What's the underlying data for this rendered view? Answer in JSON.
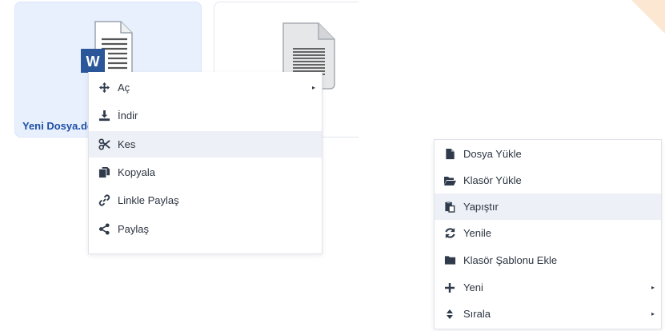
{
  "files": [
    {
      "name": "Yeni Dosya.docx",
      "type": "word-document-icon",
      "selected": true
    },
    {
      "name": "",
      "type": "text-document-icon",
      "selected": false
    }
  ],
  "file_context_menu": {
    "items": [
      {
        "label": "Aç",
        "icon": "move-icon",
        "submenu": true,
        "highlighted": false
      },
      {
        "label": "İndir",
        "icon": "download-icon",
        "submenu": false,
        "highlighted": false
      },
      {
        "label": "Kes",
        "icon": "scissors-icon",
        "submenu": false,
        "highlighted": true
      },
      {
        "label": "Kopyala",
        "icon": "copy-icon",
        "submenu": false,
        "highlighted": false
      },
      {
        "label": "Linkle Paylaş",
        "icon": "link-icon",
        "submenu": false,
        "highlighted": false
      },
      {
        "label": "Paylaş",
        "icon": "share-icon",
        "submenu": false,
        "highlighted": false
      }
    ]
  },
  "folder_context_menu": {
    "items": [
      {
        "label": "Dosya Yükle",
        "icon": "file-upload-icon",
        "submenu": false,
        "highlighted": false
      },
      {
        "label": "Klasör Yükle",
        "icon": "folder-open-icon",
        "submenu": false,
        "highlighted": false
      },
      {
        "label": "Yapıştır",
        "icon": "paste-icon",
        "submenu": false,
        "highlighted": true
      },
      {
        "label": "Yenile",
        "icon": "refresh-icon",
        "submenu": false,
        "highlighted": false
      },
      {
        "label": "Klasör Şablonu Ekle",
        "icon": "folder-icon",
        "submenu": false,
        "highlighted": false
      },
      {
        "label": "Yeni",
        "icon": "plus-icon",
        "submenu": true,
        "highlighted": false
      },
      {
        "label": "Sırala",
        "icon": "sort-icon",
        "submenu": true,
        "highlighted": false
      }
    ]
  },
  "colors": {
    "accent": "#1d4fa5",
    "selected_card": "#e9f0fd",
    "highlight": "#edf0f6",
    "word_blue": "#2b579a"
  }
}
